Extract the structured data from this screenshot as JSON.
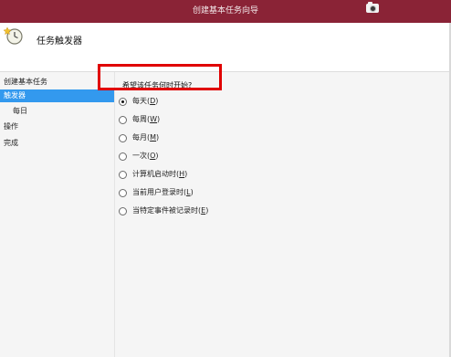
{
  "window": {
    "title": "创建基本任务向导"
  },
  "header": {
    "title": "任务触发器",
    "icon": "clock-task-icon"
  },
  "sidebar": {
    "items": [
      {
        "label": "创建基本任务",
        "active": false,
        "sub": false
      },
      {
        "label": "触发器",
        "active": true,
        "sub": false
      },
      {
        "label": "每日",
        "active": false,
        "sub": true
      },
      {
        "label": "操作",
        "active": false,
        "sub": false
      },
      {
        "label": "完成",
        "active": false,
        "sub": false
      }
    ]
  },
  "content": {
    "question": "希望该任务何时开始?",
    "options": [
      {
        "label": "每天",
        "key": "D",
        "checked": true
      },
      {
        "label": "每周",
        "key": "W",
        "checked": false
      },
      {
        "label": "每月",
        "key": "M",
        "checked": false
      },
      {
        "label": "一次",
        "key": "O",
        "checked": false
      },
      {
        "label": "计算机启动时",
        "key": "H",
        "checked": false
      },
      {
        "label": "当前用户登录时",
        "key": "L",
        "checked": false
      },
      {
        "label": "当特定事件被记录时",
        "key": "E",
        "checked": false
      }
    ]
  },
  "colors": {
    "titlebar": "#8a2336",
    "selection": "#3399ee",
    "highlight_box": "#e00000"
  }
}
